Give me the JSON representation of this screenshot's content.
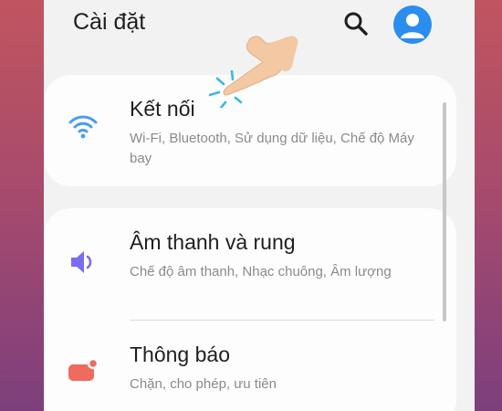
{
  "header": {
    "title": "Cài đặt",
    "search_icon": "search-icon",
    "avatar_icon": "account-icon"
  },
  "settings": {
    "items": [
      {
        "title": "Kết nối",
        "subtitle": "Wi-Fi, Bluetooth, Sử dụng dữ liệu, Chế độ Máy bay",
        "icon": "wifi-icon",
        "icon_color": "#4a9df0"
      },
      {
        "title": "Âm thanh và rung",
        "subtitle": "Chế độ âm thanh, Nhạc chuông, Âm lượng",
        "icon": "volume-icon",
        "icon_color": "#7c6cf0"
      },
      {
        "title": "Thông báo",
        "subtitle": "Chặn, cho phép, ưu tiên",
        "icon": "notification-icon",
        "icon_color": "#ef6a5f"
      }
    ]
  },
  "overlay": {
    "tap_hint_icon": "tap-hand-icon",
    "tap_hint_color": "#f3c8a3"
  },
  "colors": {
    "accent": "#2b8ded",
    "background": "#f2f2f2",
    "card": "#fdfdfd"
  }
}
